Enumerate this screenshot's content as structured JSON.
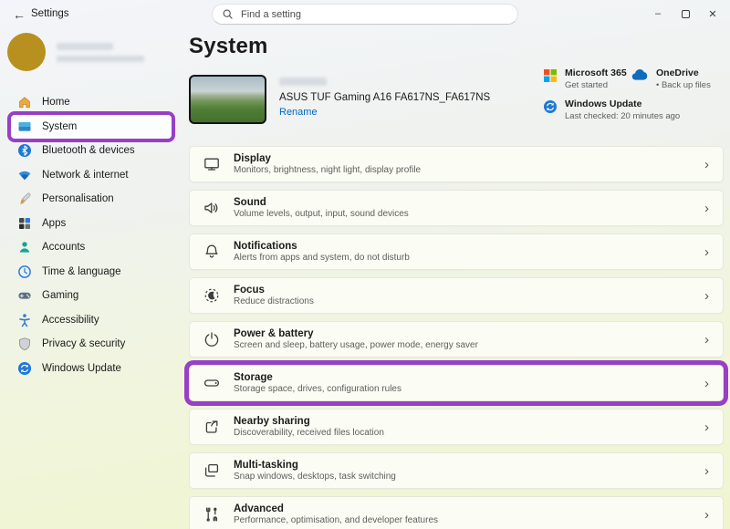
{
  "titlebar": {
    "app_title": "Settings",
    "back_glyph": "←",
    "minimize_glyph": "–",
    "close_glyph": "✕"
  },
  "search": {
    "placeholder": "Find a setting"
  },
  "sidebar": {
    "items": [
      {
        "label": "Home",
        "icon": "home-icon"
      },
      {
        "label": "System",
        "icon": "system-icon",
        "selected": true,
        "annotated": true
      },
      {
        "label": "Bluetooth & devices",
        "icon": "bluetooth-icon"
      },
      {
        "label": "Network & internet",
        "icon": "network-icon"
      },
      {
        "label": "Personalisation",
        "icon": "personalisation-icon"
      },
      {
        "label": "Apps",
        "icon": "apps-icon"
      },
      {
        "label": "Accounts",
        "icon": "accounts-icon"
      },
      {
        "label": "Time & language",
        "icon": "time-language-icon"
      },
      {
        "label": "Gaming",
        "icon": "gaming-icon"
      },
      {
        "label": "Accessibility",
        "icon": "accessibility-icon"
      },
      {
        "label": "Privacy & security",
        "icon": "privacy-icon"
      },
      {
        "label": "Windows Update",
        "icon": "windows-update-icon"
      }
    ]
  },
  "main": {
    "page_title": "System",
    "device": {
      "name": "ASUS TUF Gaming A16 FA617NS_FA617NS",
      "rename_label": "Rename"
    },
    "quick_links": [
      {
        "title": "Microsoft 365",
        "subtitle": "Get started",
        "icon": "microsoft-365-icon"
      },
      {
        "title": "OneDrive",
        "subtitle": "• Back up files",
        "icon": "onedrive-icon"
      },
      {
        "title": "Windows Update",
        "subtitle": "Last checked: 20 minutes ago",
        "icon": "windows-update-icon"
      }
    ],
    "chevron": "›",
    "cards": [
      {
        "title": "Display",
        "subtitle": "Monitors, brightness, night light, display profile",
        "icon": "display-icon"
      },
      {
        "title": "Sound",
        "subtitle": "Volume levels, output, input, sound devices",
        "icon": "sound-icon"
      },
      {
        "title": "Notifications",
        "subtitle": "Alerts from apps and system, do not disturb",
        "icon": "notifications-icon"
      },
      {
        "title": "Focus",
        "subtitle": "Reduce distractions",
        "icon": "focus-icon"
      },
      {
        "title": "Power & battery",
        "subtitle": "Screen and sleep, battery usage, power mode, energy saver",
        "icon": "power-icon"
      },
      {
        "title": "Storage",
        "subtitle": "Storage space, drives, configuration rules",
        "icon": "storage-icon",
        "annotated": true
      },
      {
        "title": "Nearby sharing",
        "subtitle": "Discoverability, received files location",
        "icon": "nearby-sharing-icon"
      },
      {
        "title": "Multi-tasking",
        "subtitle": "Snap windows, desktops, task switching",
        "icon": "multitasking-icon"
      },
      {
        "title": "Advanced",
        "subtitle": "Performance, optimisation, and developer features",
        "icon": "advanced-icon"
      }
    ]
  },
  "colors": {
    "annotation": "#983fc6",
    "link": "#0067c0"
  }
}
